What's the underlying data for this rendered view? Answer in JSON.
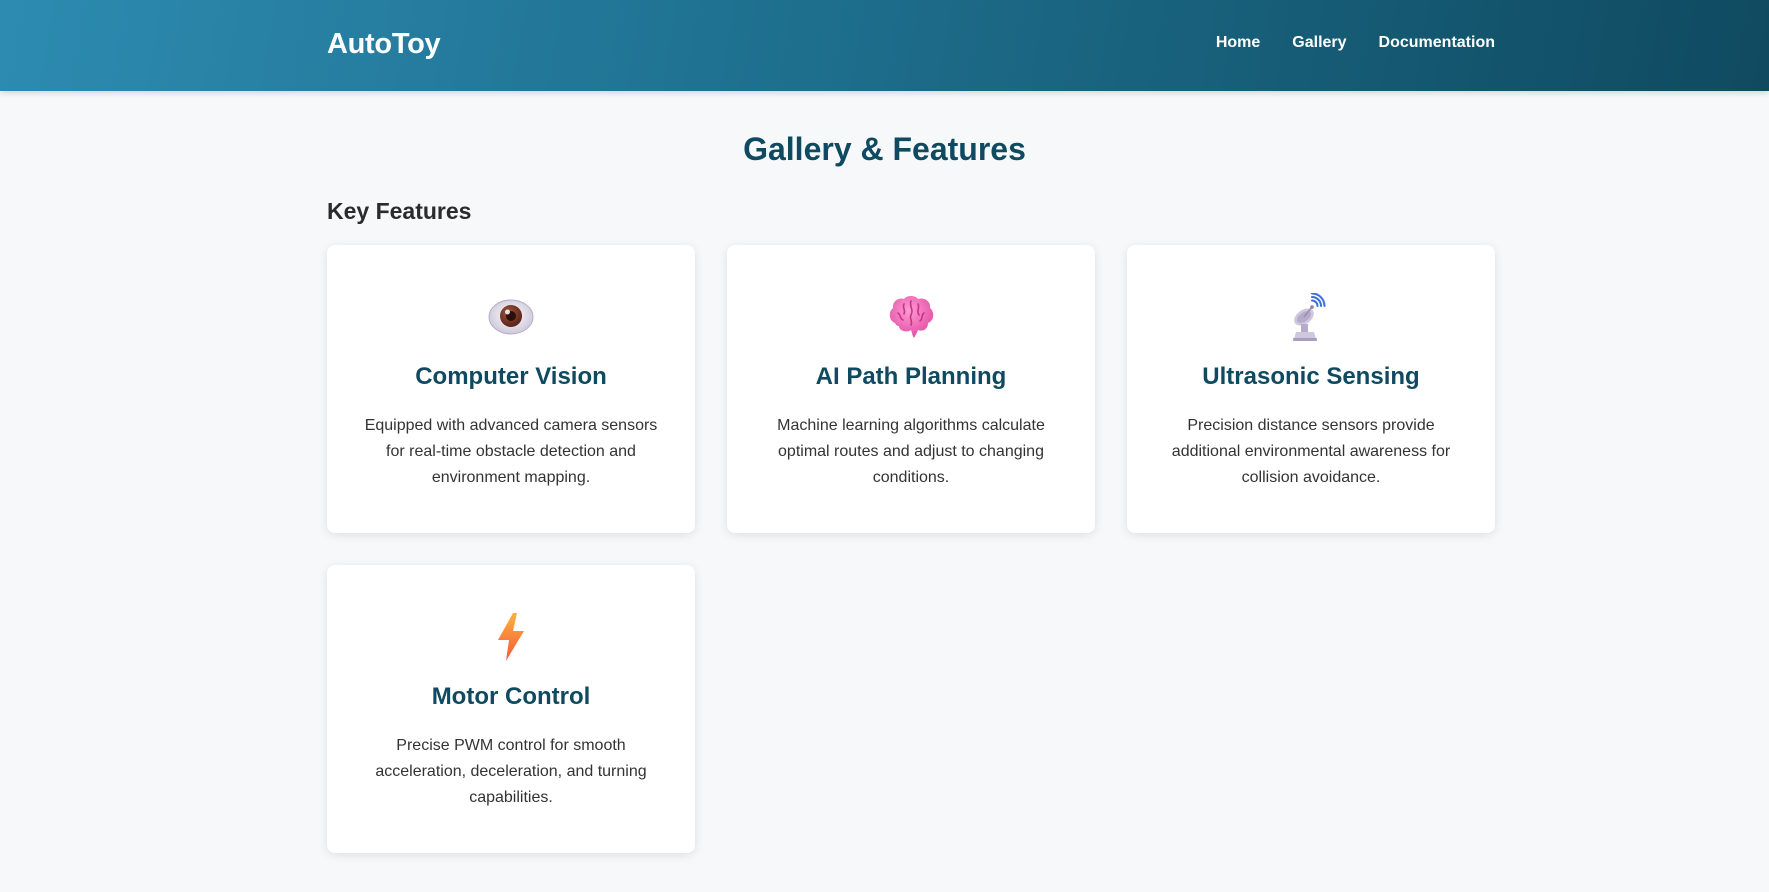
{
  "header": {
    "logo": "AutoToy",
    "nav": [
      "Home",
      "Gallery",
      "Documentation"
    ]
  },
  "main": {
    "title": "Gallery & Features",
    "section_title": "Key Features",
    "features": [
      {
        "icon": "eye-icon",
        "title": "Computer Vision",
        "description": "Equipped with advanced camera sensors for real-time obstacle detection and environment mapping."
      },
      {
        "icon": "brain-icon",
        "title": "AI Path Planning",
        "description": "Machine learning algorithms calculate optimal routes and adjust to changing conditions."
      },
      {
        "icon": "satellite-dish-icon",
        "title": "Ultrasonic Sensing",
        "description": "Precision distance sensors provide additional environmental awareness for collision avoidance."
      },
      {
        "icon": "lightning-bolt-icon",
        "title": "Motor Control",
        "description": "Precise PWM control for smooth acceleration, deceleration, and turning capabilities."
      }
    ]
  },
  "colors": {
    "header_start": "#2d8bb1",
    "header_end": "#0f4a60",
    "title": "#0f4a60",
    "background": "#f6f8fa"
  }
}
